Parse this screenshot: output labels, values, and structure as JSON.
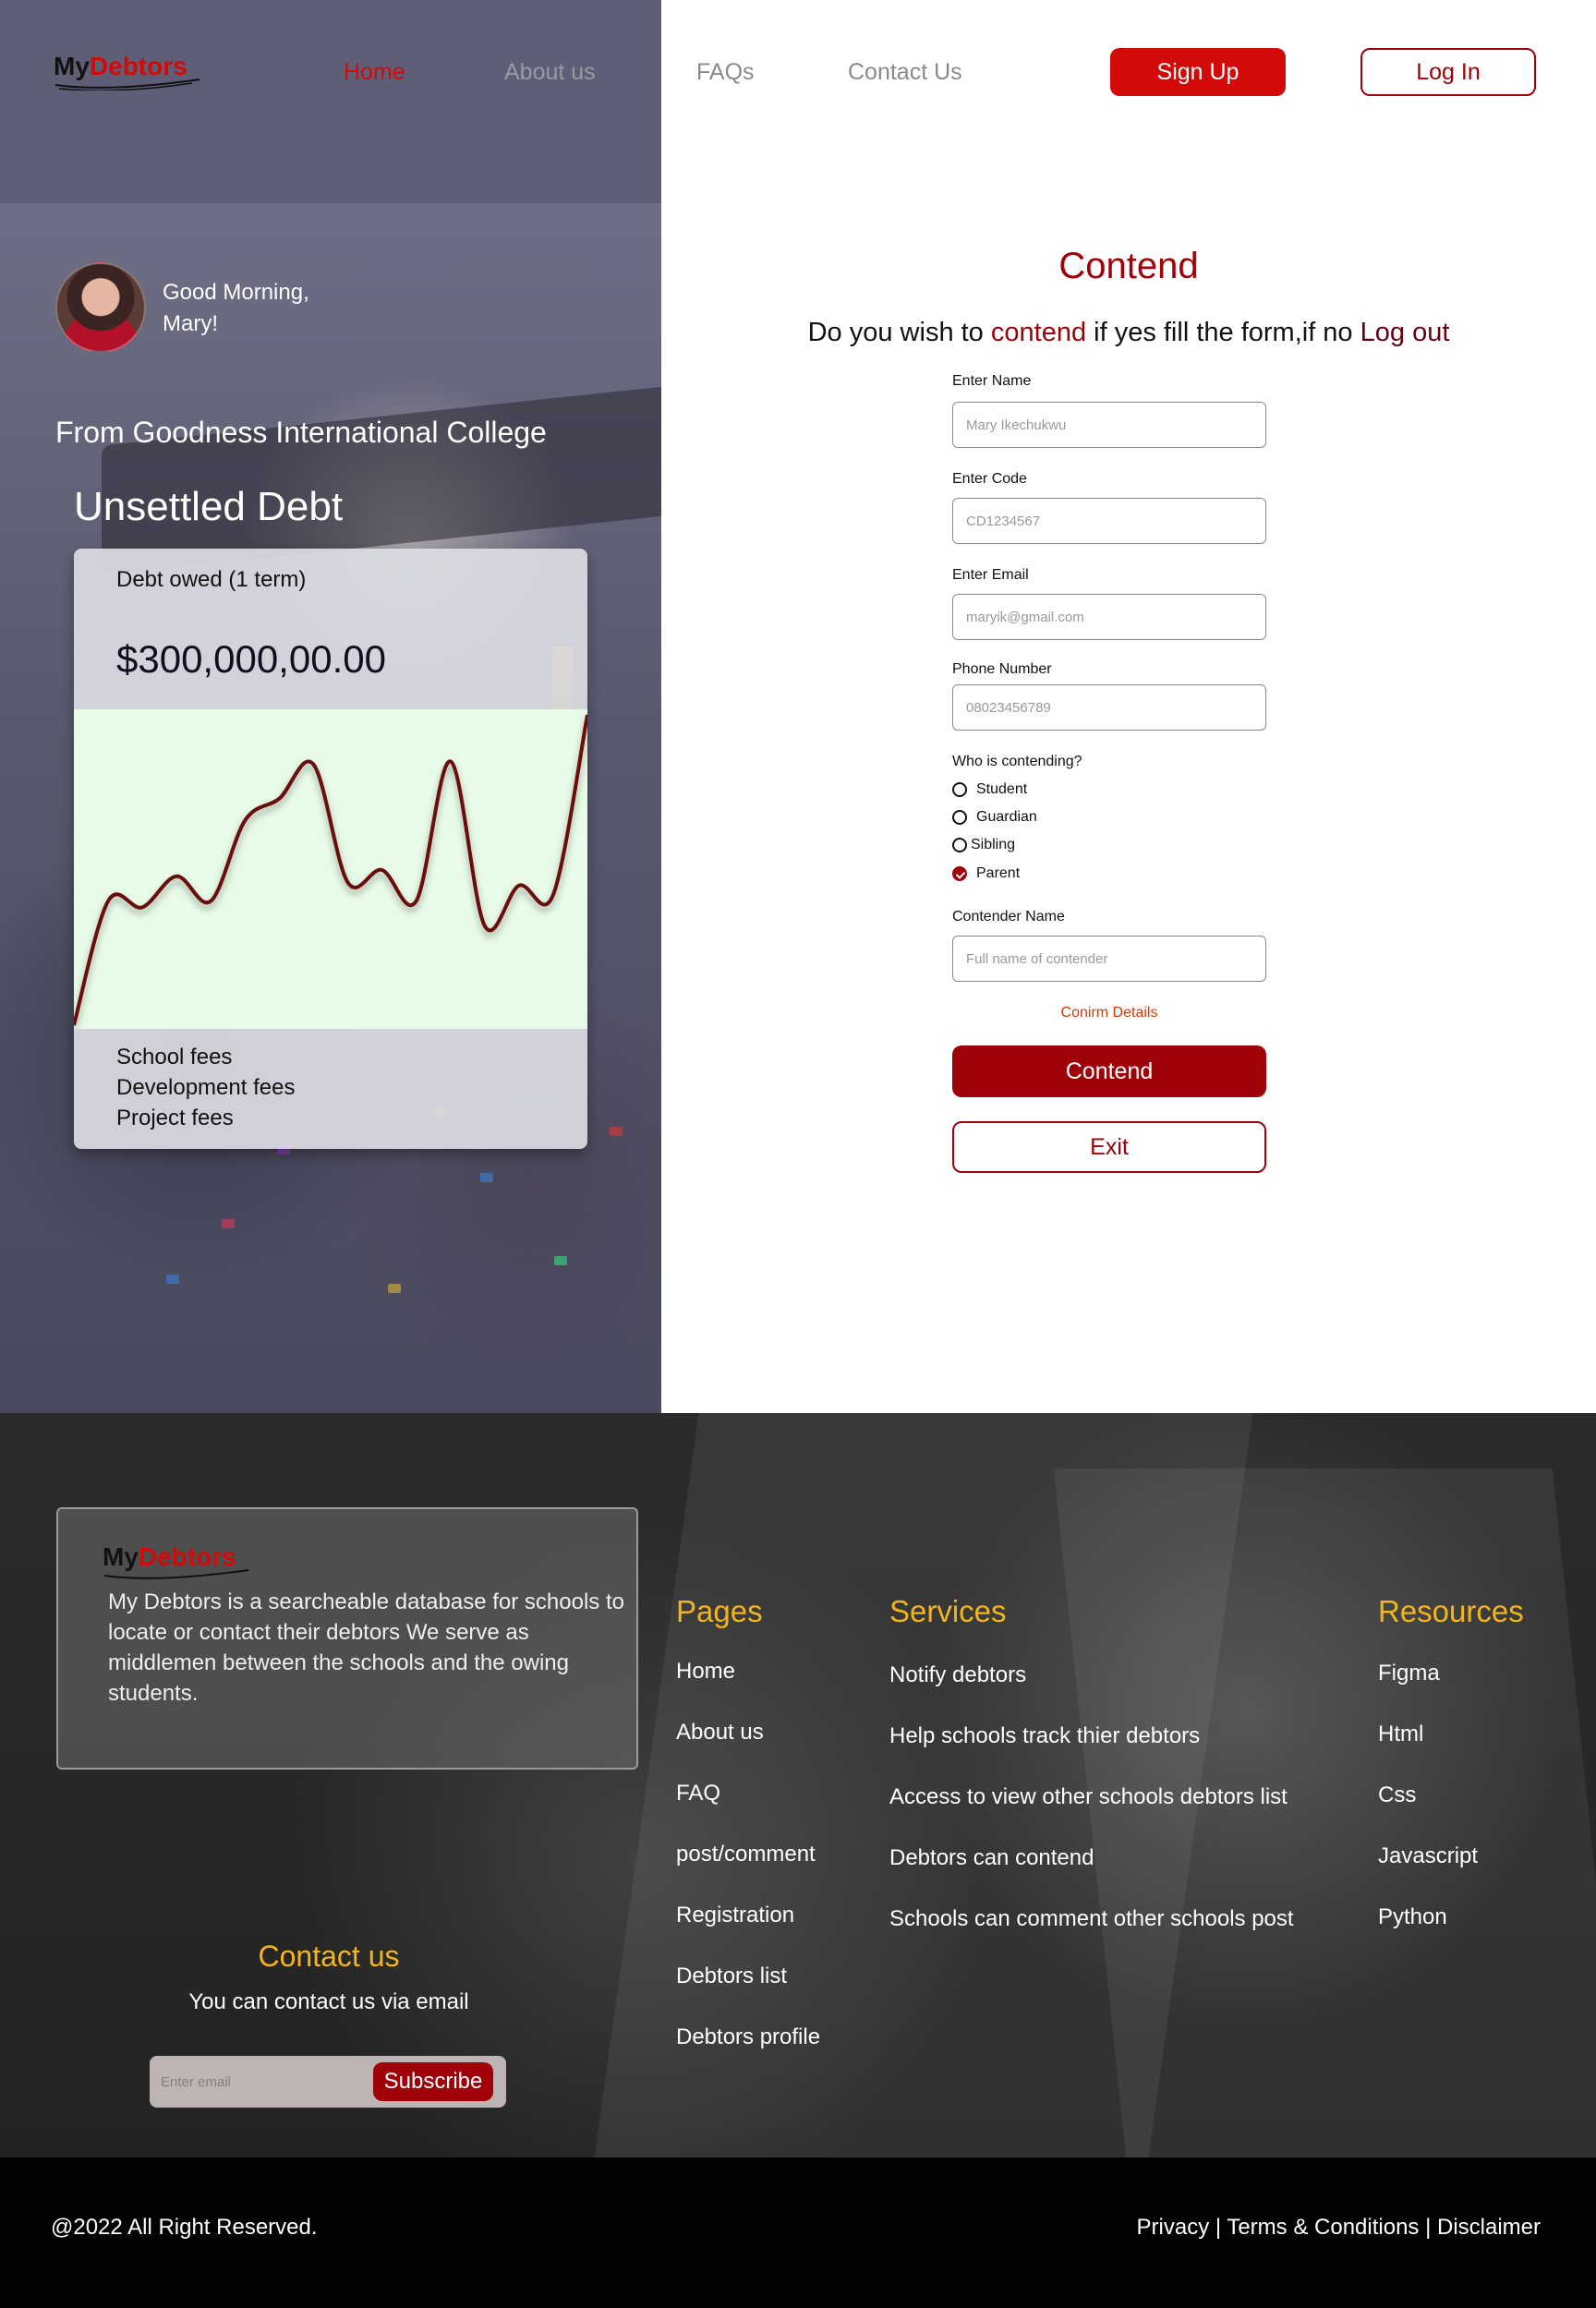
{
  "brand": {
    "my": "My",
    "debtors": "Debtors"
  },
  "nav": {
    "items": [
      {
        "label": "Home",
        "active": true
      },
      {
        "label": "About us"
      },
      {
        "label": "FAQs"
      },
      {
        "label": "Contact Us"
      }
    ],
    "signup": "Sign Up",
    "login": "Log In"
  },
  "hero": {
    "greeting_line1": "Good Morning,",
    "greeting_line2": "Mary!",
    "college": "From Goodness International College",
    "unsettled": "Unsettled Debt",
    "debt_label": "Debt owed (1 term)",
    "debt_amount": "$300,000,00.00",
    "fees": [
      "School fees",
      "Development fees",
      "Project fees"
    ]
  },
  "chart_data": {
    "type": "line",
    "series_values": [
      0,
      40,
      38,
      48,
      40,
      66,
      73,
      84,
      46,
      50,
      40,
      85,
      32,
      45,
      42,
      100
    ]
  },
  "form": {
    "title": "Contend",
    "subtitle_pre": "Do you wish to ",
    "subtitle_contend": "contend",
    "subtitle_mid": " if yes fill the form,if no ",
    "subtitle_logout": "Log out",
    "name_label": "Enter Name",
    "name_value": "Mary Ikechukwu",
    "code_label": "Enter Code",
    "code_value": "CD1234567",
    "email_label": "Enter Email",
    "email_value": "maryik@gmail.com",
    "phone_label": "Phone Number",
    "phone_value": "08023456789",
    "who_label": "Who is contending?",
    "options": [
      {
        "label": "Student",
        "checked": false
      },
      {
        "label": "Guardian",
        "checked": false
      },
      {
        "label": "Sibling",
        "checked": false
      },
      {
        "label": "Parent",
        "checked": true
      }
    ],
    "contender_label": "Contender Name",
    "contender_placeholder": "Full name of contender",
    "confirm_text": "Conirm Details",
    "contend_btn": "Contend",
    "exit_btn": "Exit"
  },
  "footer": {
    "about": "My Debtors is a searcheable database for schools to locate or contact their debtors We serve as middlemen between the schools and the owing students.",
    "pages_title": "Pages",
    "pages": [
      "Home",
      "About us",
      "FAQ",
      "post/comment",
      "Registration",
      "Debtors list",
      "Debtors profile"
    ],
    "services_title": "Services",
    "services": [
      "Notify debtors",
      "Help schools track thier debtors",
      "Access to view other schools debtors list",
      "Debtors can contend",
      "Schools can comment other schools post"
    ],
    "resources_title": "Resources",
    "resources": [
      "Figma",
      "Html",
      "Css",
      "Javascript",
      "Python"
    ],
    "contact_title": "Contact us",
    "contact_sub": "You can contact us via email",
    "subscribe_placeholder": "Enter email",
    "subscribe_btn": "Subscribe",
    "copyright": "@2022 All Right Reserved.",
    "legal": "Privacy | Terms & Conditions | Disclaimer"
  },
  "colors": {
    "accent_red": "#a0020a",
    "bright_red": "#d20a0a",
    "gold": "#f3b51c",
    "chart_line": "#6a0a10",
    "chart_bg": "#e8fbe8"
  }
}
